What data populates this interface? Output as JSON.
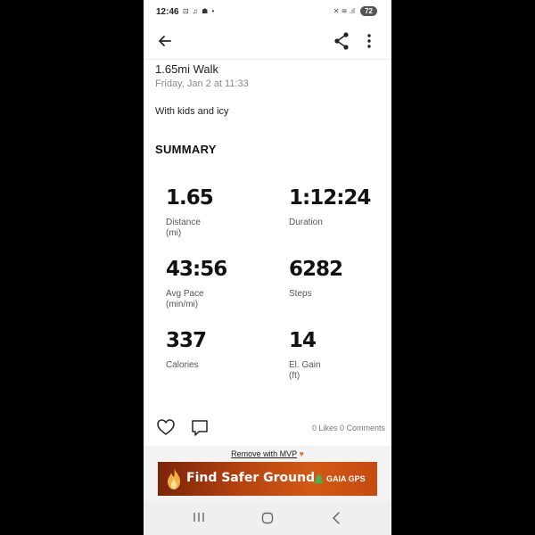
{
  "status_bar": {
    "time": "12:46",
    "notification_icons": "⊡ ♫ ☗ •",
    "right_icons": "✕ ≋ .ıl",
    "battery": "72"
  },
  "activity": {
    "title": "1.65mi Walk",
    "date": "Friday, Jan 2 at 11:33",
    "description": "With kids and icy"
  },
  "summary": {
    "heading": "SUMMARY",
    "stats": [
      {
        "value": "1.65",
        "label": "Distance",
        "unit": "(mi)"
      },
      {
        "value": "1:12:24",
        "label": "Duration",
        "unit": ""
      },
      {
        "value": "43:56",
        "label": "Avg Pace",
        "unit": "(min/mi)"
      },
      {
        "value": "6282",
        "label": "Steps",
        "unit": ""
      },
      {
        "value": "337",
        "label": "Calories",
        "unit": ""
      },
      {
        "value": "14",
        "label": "El. Gain",
        "unit": "(ft)"
      }
    ]
  },
  "social": {
    "counts": "0 Likes 0 Comments"
  },
  "promo": {
    "remove_link": "Remove with MVP",
    "heart": "♥",
    "ad_text": "Find Safer Ground",
    "ad_brand": "GAIA GPS"
  },
  "colors": {
    "accent_orange": "#e87522",
    "ad_gradient_start": "#7a2408",
    "ad_gradient_end": "#d35a15"
  },
  "icons": {
    "back": "arrow-left",
    "share": "share",
    "more": "more-vertical",
    "like": "heart-outline",
    "comment": "comment-bubble",
    "nav_recents": "recents",
    "nav_home": "home",
    "nav_back": "chevron-left"
  }
}
